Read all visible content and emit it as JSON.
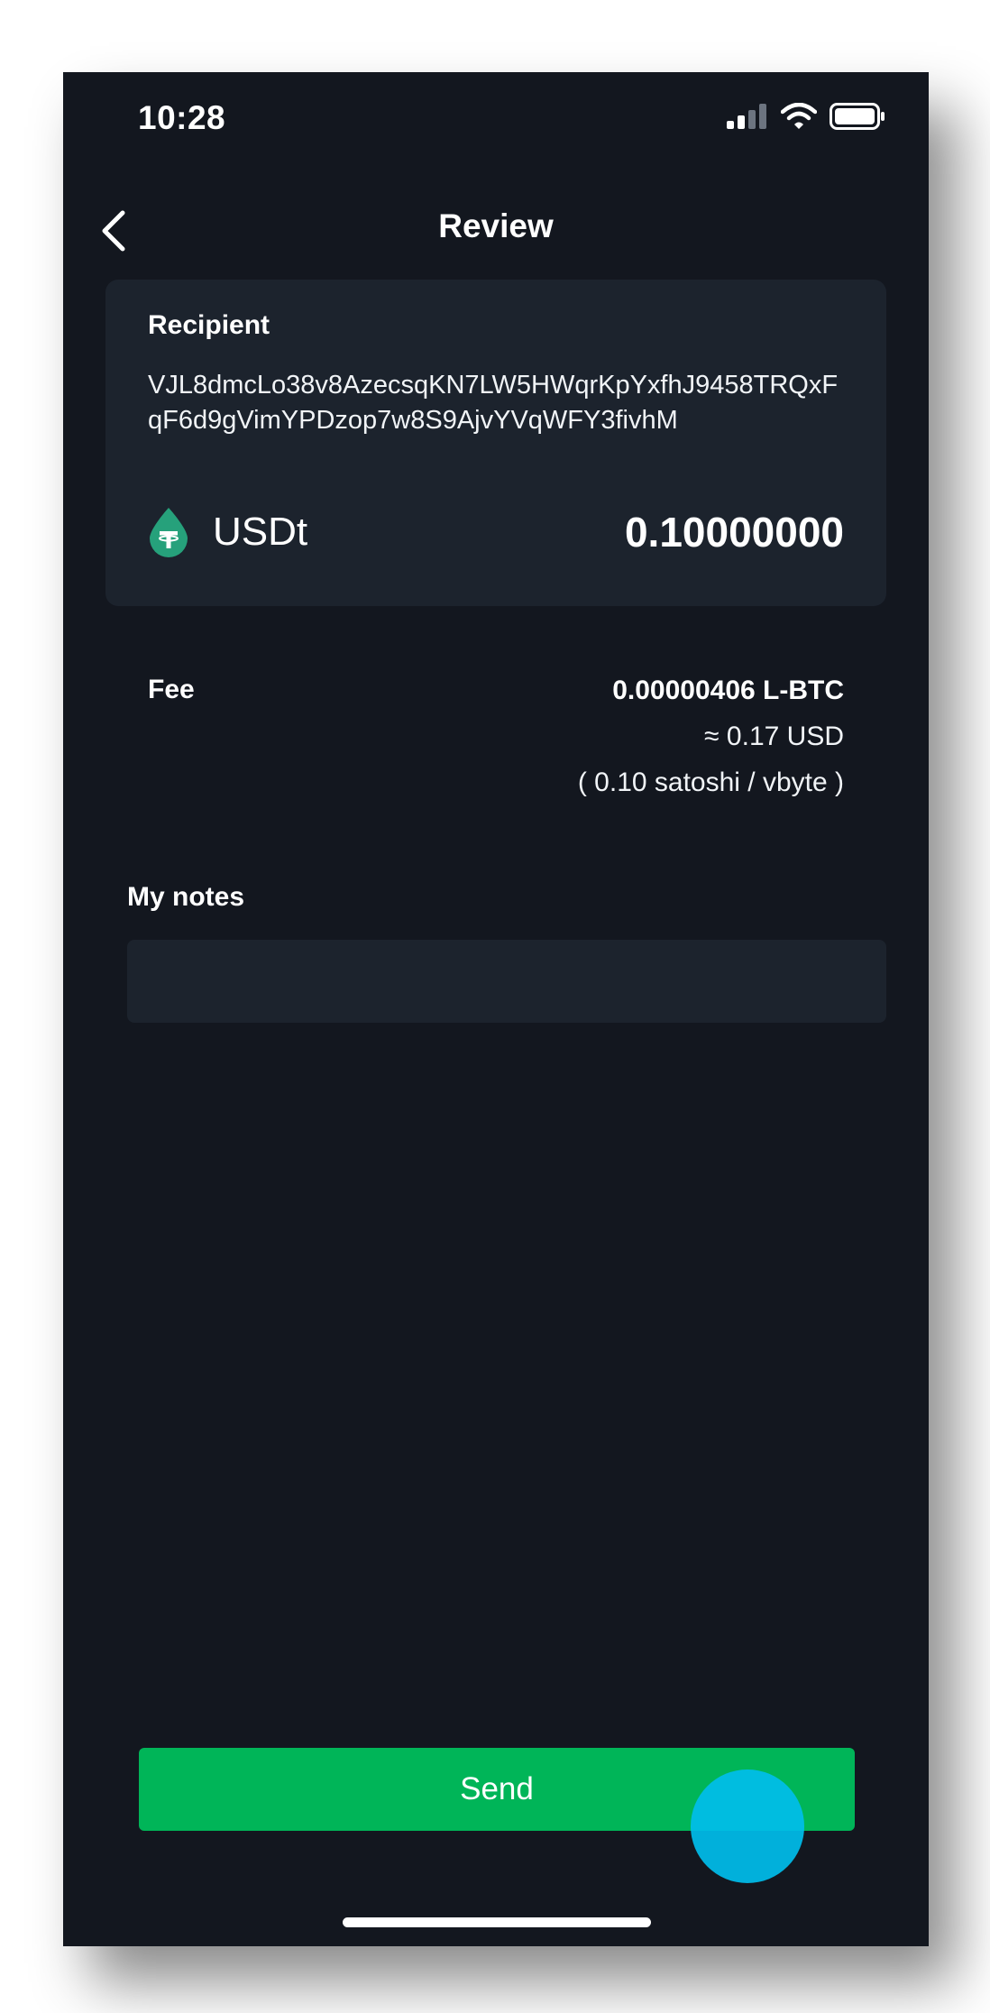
{
  "status_bar": {
    "time": "10:28"
  },
  "header": {
    "title": "Review"
  },
  "recipient": {
    "label": "Recipient",
    "address": "VJL8dmcLo38v8AzecsqKN7LW5HWqrKpYxfhJ9458TRQxFqF6d9gVimYPDzop7w8S9AjvYVqWFY3fivhM",
    "asset_name": "USDt",
    "asset_icon": "tether-drop-icon",
    "amount": "0.10000000"
  },
  "fee": {
    "label": "Fee",
    "amount": "0.00000406 L-BTC",
    "usd": "≈ 0.17 USD",
    "rate": "( 0.10 satoshi / vbyte )"
  },
  "notes": {
    "label": "My notes",
    "value": "",
    "placeholder": ""
  },
  "actions": {
    "send_label": "Send"
  },
  "colors": {
    "background": "#13171f",
    "card": "#1c232d",
    "accent_green": "#00b558",
    "tether": "#26a17b",
    "touch_indicator": "#00bee6"
  }
}
